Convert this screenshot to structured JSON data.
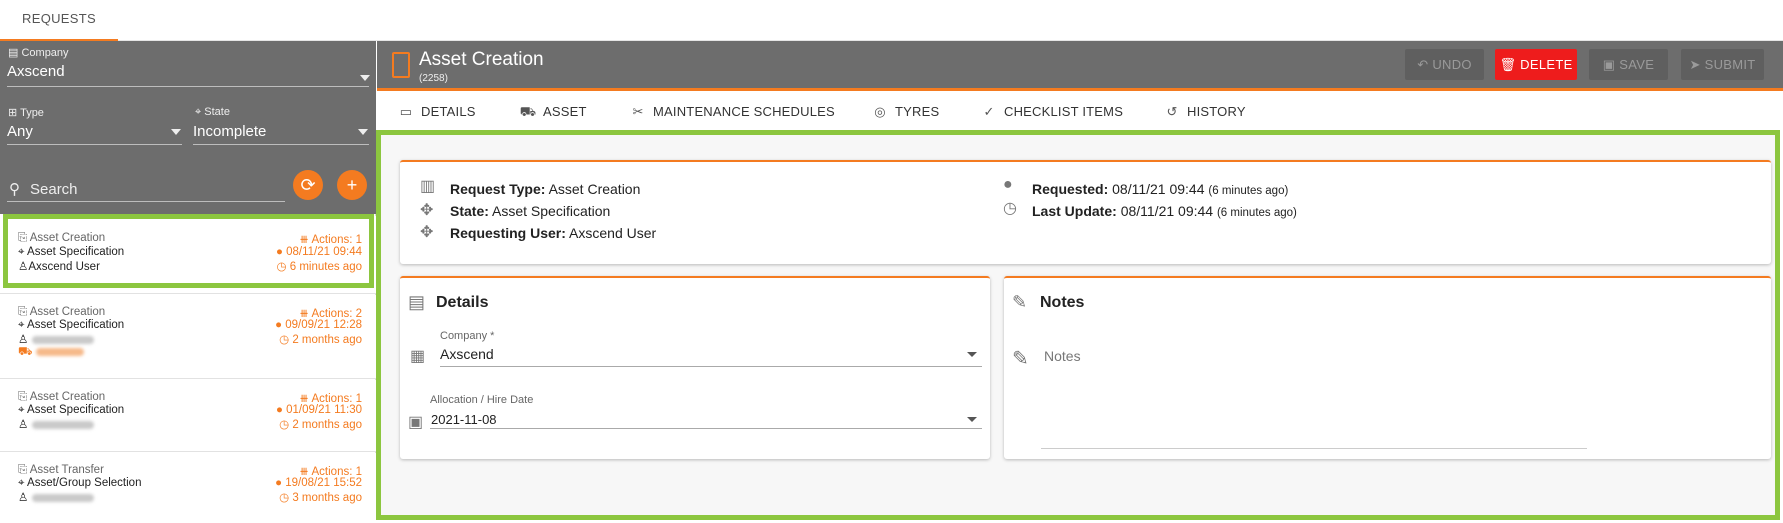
{
  "top_tab": "REQUESTS",
  "filters": {
    "company_label": "Company",
    "company_value": "Axscend",
    "type_label": "Type",
    "type_value": "Any",
    "state_label": "State",
    "state_value": "Incomplete",
    "search_placeholder": "Search"
  },
  "requests": [
    {
      "type": "Asset Creation",
      "state": "Asset Specification",
      "user": "Axscend User",
      "actions": "Actions: 1",
      "date": "08/11/21 09:44",
      "ago": "6 minutes ago"
    },
    {
      "type": "Asset Creation",
      "state": "Asset Specification",
      "user": "",
      "actions": "Actions: 2",
      "date": "09/09/21 12:28",
      "ago": "2 months ago"
    },
    {
      "type": "Asset Creation",
      "state": "Asset Specification",
      "user": "",
      "actions": "Actions: 1",
      "date": "01/09/21 11:30",
      "ago": "2 months ago"
    },
    {
      "type": "Asset Transfer",
      "state": "Asset/Group Selection",
      "user": "",
      "actions": "Actions: 1",
      "date": "19/08/21 15:52",
      "ago": "3 months ago"
    }
  ],
  "header": {
    "title": "Asset Creation",
    "subtitle": "(2258)",
    "undo": "UNDO",
    "delete": "DELETE",
    "save": "SAVE",
    "submit": "SUBMIT"
  },
  "tabs": [
    "DETAILS",
    "ASSET",
    "MAINTENANCE SCHEDULES",
    "TYRES",
    "CHECKLIST ITEMS",
    "HISTORY"
  ],
  "summary": {
    "request_type_label": "Request Type:",
    "request_type_value": "Asset Creation",
    "state_label": "State:",
    "state_value": "Asset Specification",
    "user_label": "Requesting User:",
    "user_value": "Axscend User",
    "requested_label": "Requested:",
    "requested_value": "08/11/21 09:44",
    "requested_ago": "(6 minutes ago)",
    "updated_label": "Last Update:",
    "updated_value": "08/11/21 09:44",
    "updated_ago": "(6 minutes ago)"
  },
  "details": {
    "title": "Details",
    "company_label": "Company *",
    "company_value": "Axscend",
    "date_label": "Allocation / Hire Date",
    "date_value": "2021-11-08"
  },
  "notes": {
    "title": "Notes",
    "placeholder": "Notes"
  },
  "colors": {
    "accent": "#f47b20",
    "highlight": "#8cc63f",
    "delete": "#ee1c1c",
    "header": "#6d6d6d"
  }
}
